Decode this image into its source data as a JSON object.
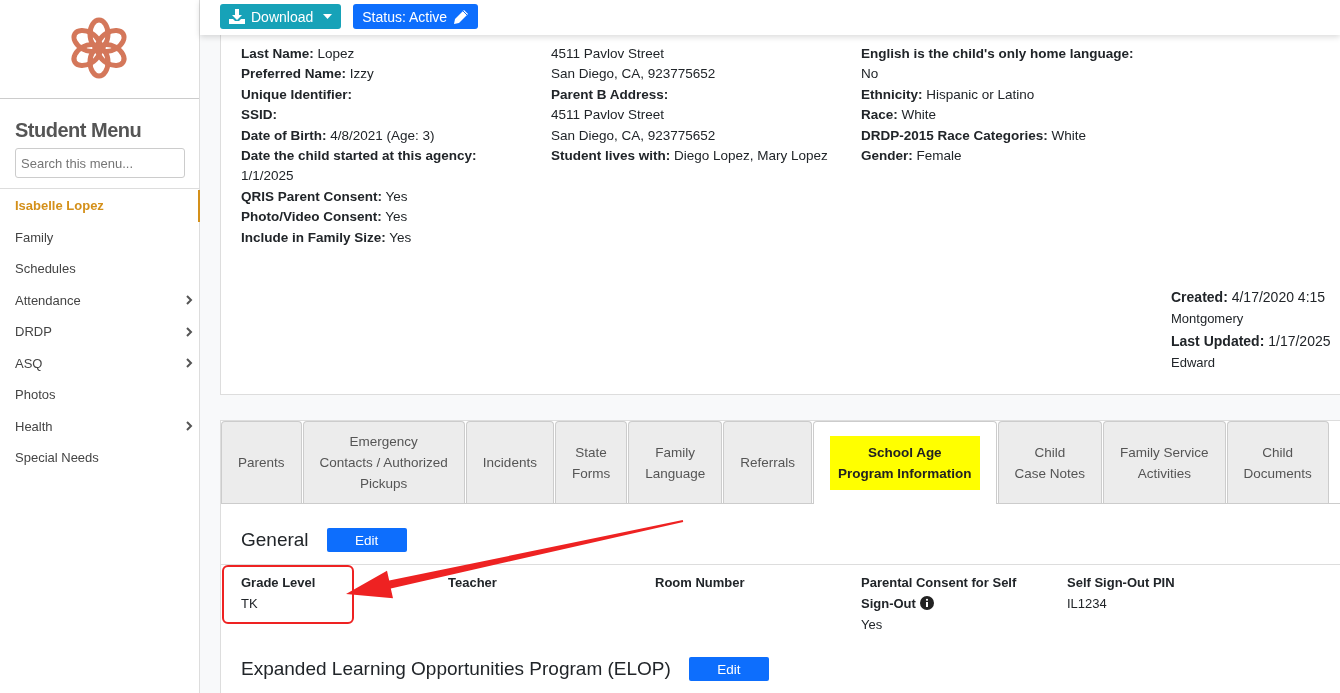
{
  "toolbar": {
    "buttons": [
      {
        "kind": "download",
        "label": "Download"
      },
      {
        "kind": "status",
        "label": "Status: Active"
      }
    ]
  },
  "sidebar": {
    "title": "Student Menu",
    "search": {
      "placeholder": "Search this menu..."
    },
    "items": [
      {
        "label": "Isabelle Lopez",
        "selected": true,
        "expandable": false
      },
      {
        "label": "Family",
        "selected": false,
        "expandable": false
      },
      {
        "label": "Schedules",
        "selected": false,
        "expandable": false
      },
      {
        "label": "Attendance",
        "selected": false,
        "expandable": true
      },
      {
        "label": "DRDP",
        "selected": false,
        "expandable": true
      },
      {
        "label": "ASQ",
        "selected": false,
        "expandable": true
      },
      {
        "label": "Photos",
        "selected": false,
        "expandable": false
      },
      {
        "label": "Health",
        "selected": false,
        "expandable": true
      },
      {
        "label": "Special Needs",
        "selected": false,
        "expandable": false
      }
    ]
  },
  "profile": {
    "columns": [
      [
        {
          "label": "Last Name:",
          "value": "Lopez"
        },
        {
          "label": "Preferred Name:",
          "value": "Izzy"
        },
        {
          "label": "Unique Identifier:"
        },
        {
          "label": "SSID:"
        },
        {
          "label": "Date of Birth:",
          "value": "4/8/2021 (Age: 3)"
        },
        {
          "label": "Date the child started at this agency:",
          "lines": [
            "1/1/2025"
          ]
        },
        {
          "label": "QRIS Parent Consent:",
          "value": "Yes"
        },
        {
          "label": "Photo/Video Consent:",
          "value": "Yes"
        },
        {
          "label": "Include in Family Size:",
          "value": "Yes"
        }
      ],
      [
        {
          "lines": [
            "4511 Pavlov Street",
            "San Diego, CA, 923775652"
          ]
        },
        {
          "label": "Parent B Address:",
          "lines": [
            "4511 Pavlov Street",
            "San Diego, CA, 923775652"
          ]
        },
        {
          "label": "Student lives with:",
          "value": "Diego Lopez, Mary Lopez"
        }
      ],
      [
        {
          "label": "English is the child's only home language:",
          "lines": [
            "No"
          ]
        },
        {
          "label": "Ethnicity:",
          "value": "Hispanic or Latino"
        },
        {
          "label": "Race:",
          "value": "White"
        },
        {
          "label": "DRDP-2015 Race Categories:",
          "value": "White"
        },
        {
          "label": "Gender:",
          "value": "Female"
        }
      ]
    ],
    "audit": [
      {
        "label": "Created:",
        "value": "4/17/2020 4:15",
        "by": "Montgomery"
      },
      {
        "label": "Last Updated:",
        "value": "1/17/2025",
        "by": "Edward"
      }
    ]
  },
  "tabs": [
    {
      "lines": [
        "Parents"
      ],
      "selected": false
    },
    {
      "lines": [
        "Emergency",
        "Contacts / Authorized",
        "Pickups"
      ],
      "selected": false
    },
    {
      "lines": [
        "Incidents"
      ],
      "selected": false
    },
    {
      "lines": [
        "State",
        "Forms"
      ],
      "selected": false
    },
    {
      "lines": [
        "Family",
        "Language"
      ],
      "selected": false
    },
    {
      "lines": [
        "Referrals"
      ],
      "selected": false
    },
    {
      "lines": [
        "School Age",
        "Program Information"
      ],
      "selected": true
    },
    {
      "lines": [
        "Child",
        "Case Notes"
      ],
      "selected": false
    },
    {
      "lines": [
        "Family Service",
        "Activities"
      ],
      "selected": false
    },
    {
      "lines": [
        "Child",
        "Documents"
      ],
      "selected": false
    }
  ],
  "sections": [
    {
      "title": "General",
      "button": "Edit",
      "fields": [
        {
          "label": "Grade Level",
          "lines": [
            "TK"
          ],
          "info": false,
          "highlighted": true
        },
        {
          "label": "Teacher",
          "info": false,
          "highlighted": false
        },
        {
          "label": "Room Number",
          "info": false,
          "highlighted": false
        },
        {
          "label": "Parental Consent for Self Sign-Out",
          "lines": [
            "Yes"
          ],
          "info": true,
          "highlighted": false
        },
        {
          "label": "Self Sign-Out PIN",
          "lines": [
            "IL1234"
          ],
          "info": false,
          "highlighted": false
        }
      ]
    },
    {
      "title": "Expanded Learning Opportunities Program (ELOP)",
      "button": "Edit"
    }
  ],
  "annotations": [
    {
      "kind": "arrow"
    }
  ]
}
